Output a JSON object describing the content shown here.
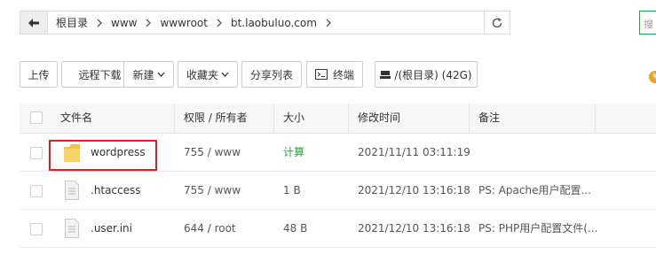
{
  "pathbar": {
    "crumbs": [
      "根目录",
      "www",
      "wwwroot",
      "bt.laobuluo.com"
    ],
    "search_placeholder": "搜"
  },
  "toolbar": {
    "upload": "上传",
    "remote_download": "远程下载",
    "new": "新建",
    "favorites": "收藏夹",
    "share_list": "分享列表",
    "terminal": "终端",
    "disk": "/(根目录) (42G)"
  },
  "table": {
    "headers": {
      "name": "文件名",
      "perms": "权限 / 所有者",
      "size": "大小",
      "mtime": "修改时间",
      "note": "备注"
    },
    "rows": [
      {
        "name": "wordpress",
        "type": "folder",
        "perms": "755 / www",
        "size": "计算",
        "mtime": "2021/11/11 03:11:19",
        "note": ""
      },
      {
        "name": ".htaccess",
        "type": "file",
        "perms": "755 / www",
        "size": "1 B",
        "mtime": "2021/12/10 13:16:18",
        "note": "PS: Apache用户配置..."
      },
      {
        "name": ".user.ini",
        "type": "file",
        "perms": "644 / root",
        "size": "48 B",
        "mtime": "2021/12/10 13:16:18",
        "note": "PS: PHP用户配置文件(..."
      }
    ]
  },
  "colors": {
    "accent": "#20a53a",
    "highlight": "#e0201e",
    "folder": "#f5c342"
  }
}
